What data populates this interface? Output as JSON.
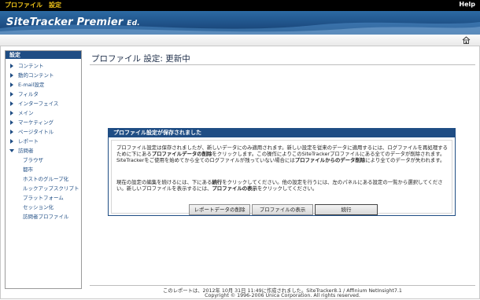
{
  "topbar": {
    "menu_profile": "プロファイル",
    "menu_settings": "設定",
    "help": "Help"
  },
  "banner": {
    "logo_main": "SiteTracker Premier",
    "logo_edition": "Ed."
  },
  "sidebar": {
    "header": "設定",
    "items": [
      {
        "label": "コンテント"
      },
      {
        "label": "動的コンテント"
      },
      {
        "label": "E-mail設定"
      },
      {
        "label": "フィルタ"
      },
      {
        "label": "インターフェイス"
      },
      {
        "label": "メイン"
      },
      {
        "label": "マーケティング"
      },
      {
        "label": "ページタイトル"
      },
      {
        "label": "レポート"
      },
      {
        "label": "訪問者"
      }
    ],
    "subitems": [
      {
        "label": "ブラウザ"
      },
      {
        "label": "都市"
      },
      {
        "label": "ホストのグループ化"
      },
      {
        "label": "ルックアップスクリプト"
      },
      {
        "label": "プラットフォーム"
      },
      {
        "label": "セッション化"
      },
      {
        "label": "訪問者プロファイル"
      }
    ]
  },
  "main": {
    "title": "プロファイル 設定: 更新中"
  },
  "dialog": {
    "title": "プロファイル設定が保存されました",
    "p1_part1": "プロファイル設定は保存されましたが、新しいデータにのみ適用されます。新しい設定を従来のデータに適用するには、ログファイルを再処理するために下にある",
    "p1_bold1": "プロファイルデータの削除",
    "p1_part2": "をクリックします。この操作によりこのSiteTrackerプロファイルにある全てのデータが削除されます。SiteTrackerをご使用を始めてから全てのログファイルが残っていない場合には",
    "p1_bold2": "プロファイルからのデータ削除",
    "p1_part3": "により全てのデータが失われます。",
    "p2_part1": "現在の設定の編集を続けるには、下にある",
    "p2_bold1": "続行",
    "p2_part2": "をクリックしてください。他の設定を行うには、左のパネルにある設定の一覧から選択してください。新しいプロファイルを表示するには、",
    "p2_bold2": "プロファイルの表示",
    "p2_part3": "をクリックしてください。",
    "btn_delete": "レポートデータの削除",
    "btn_view": "プロファイルの表示",
    "btn_continue": "続行"
  },
  "footer": {
    "line1": "このレポートは、2012年 10月 31日 11:49に作成されました。SiteTracker8.1 / Affinium NetInsight7.1",
    "line2": "Copyright © 1996-2006 Unica Corporation. All rights reserved."
  },
  "colors": {
    "nav_blue": "#1f4d84",
    "menu_yellow": "#f0c419"
  },
  "icons": {
    "toolbar": "home-icon"
  }
}
